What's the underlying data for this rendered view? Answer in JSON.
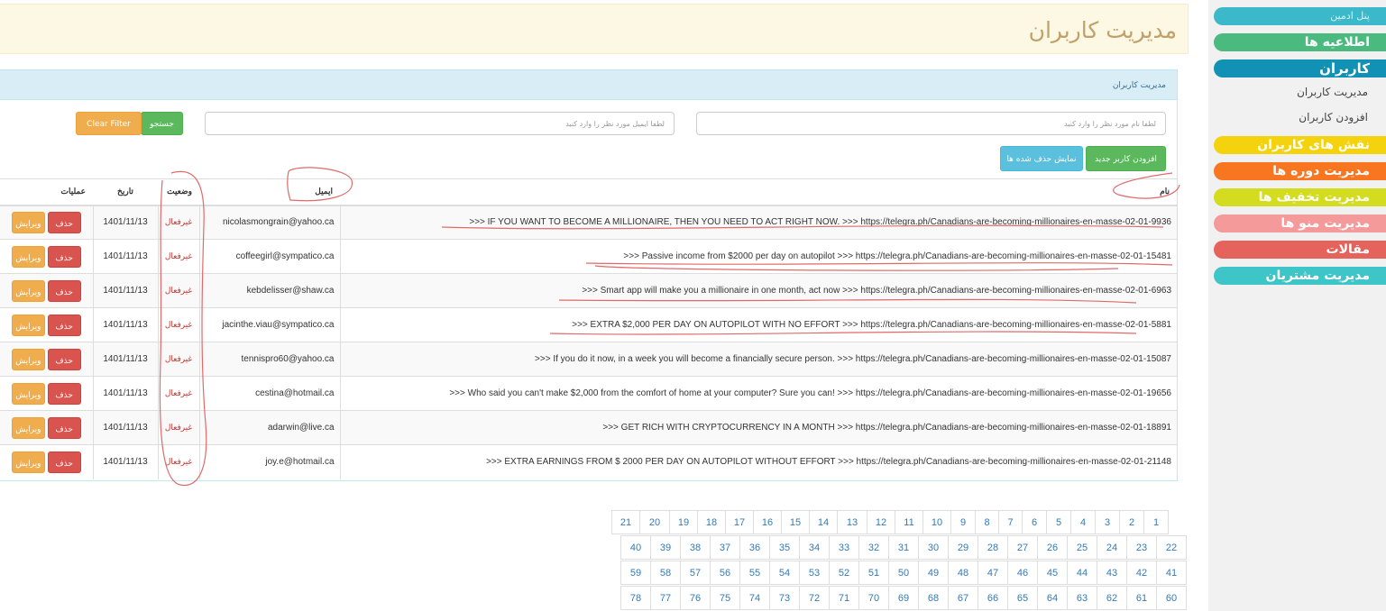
{
  "page_title": "مدیریت کاربران",
  "sidebar": {
    "items": [
      {
        "label": "پنل ادمین",
        "color": "#3bb8c9"
      },
      {
        "label": "اطلاعیه ها",
        "color": "#4aba7f"
      },
      {
        "label": "کاربران",
        "color": "#1191b4"
      },
      {
        "label": "نقش های کاربران",
        "color": "#f5d20e"
      },
      {
        "label": "مدیریت دوره ها",
        "color": "#f97621"
      },
      {
        "label": "مدیریت تخفیف ها",
        "color": "#d4dc1f"
      },
      {
        "label": "مدیریت منو ها",
        "color": "#f49a9a"
      },
      {
        "label": "مقالات",
        "color": "#e5635b"
      },
      {
        "label": "مدیریت مشتریان",
        "color": "#3ec5c8"
      }
    ],
    "subitems": [
      "مدیریت کاربران",
      "افزودن کاربران"
    ]
  },
  "panel": {
    "heading": "مدیریت کاربران",
    "name_placeholder": "لطفا نام مورد نظر را وارد کنید",
    "email_placeholder": "لطفا ایمیل مورد نظر را وارد کنید",
    "search_label": "جستجو",
    "clear_filter_label": "Clear Filter",
    "add_user_label": "افزودن کاربر جدید",
    "show_deleted_label": "نمایش حذف شده ها"
  },
  "table": {
    "headers": {
      "name": "نام",
      "email": "ایمیل",
      "status": "وضعیت",
      "date": "تاریخ",
      "ops": "عملیات"
    },
    "delete_label": "حذف",
    "edit_label": "ویرایش",
    "rows": [
      {
        "name": ">>> IF YOU WANT TO BECOME A MILLIONAIRE, THEN YOU NEED TO ACT RIGHT NOW. >>> https://telegra.ph/Canadians-are-becoming-millionaires-en-masse-02-01-9936",
        "email": "nicolasmongrain@yahoo.ca",
        "status": "غیرفعال",
        "date": "1401/11/13"
      },
      {
        "name": ">>> Passive income from $2000 per day on autopilot >>> https://telegra.ph/Canadians-are-becoming-millionaires-en-masse-02-01-15481",
        "email": "coffeegirl@sympatico.ca",
        "status": "غیرفعال",
        "date": "1401/11/13"
      },
      {
        "name": ">>> Smart app will make you a millionaire in one month, act now >>> https://telegra.ph/Canadians-are-becoming-millionaires-en-masse-02-01-6963",
        "email": "kebdelisser@shaw.ca",
        "status": "غیرفعال",
        "date": "1401/11/13"
      },
      {
        "name": ">>> EXTRA $2,000 PER DAY ON AUTOPILOT WITH NO EFFORT >>> https://telegra.ph/Canadians-are-becoming-millionaires-en-masse-02-01-5881",
        "email": "jacinthe.viau@sympatico.ca",
        "status": "غیرفعال",
        "date": "1401/11/13"
      },
      {
        "name": ">>> If you do it now, in a week you will become a financially secure person. >>> https://telegra.ph/Canadians-are-becoming-millionaires-en-masse-02-01-15087",
        "email": "tennispro60@yahoo.ca",
        "status": "غیرفعال",
        "date": "1401/11/13"
      },
      {
        "name": ">>> Who said you can't make $2,000 from the comfort of home at your computer? Sure you can! >>> https://telegra.ph/Canadians-are-becoming-millionaires-en-masse-02-01-19656",
        "email": "cestina@hotmail.ca",
        "status": "غیرفعال",
        "date": "1401/11/13"
      },
      {
        "name": ">>> GET RICH WITH CRYPTOCURRENCY IN A MONTH >>> https://telegra.ph/Canadians-are-becoming-millionaires-en-masse-02-01-18891",
        "email": "adarwin@live.ca",
        "status": "غیرفعال",
        "date": "1401/11/13"
      },
      {
        "name": ">>> EXTRA EARNINGS FROM $ 2000 PER DAY ON AUTOPILOT WITHOUT EFFORT >>> https://telegra.ph/Canadians-are-becoming-millionaires-en-masse-02-01-21148",
        "email": "joy.e@hotmail.ca",
        "status": "غیرفعال",
        "date": "1401/11/13"
      }
    ]
  },
  "pagination": {
    "rows": [
      [
        "1",
        "2",
        "3",
        "4",
        "5",
        "6",
        "7",
        "8",
        "9",
        "10",
        "11",
        "12",
        "13",
        "14",
        "15",
        "16",
        "17",
        "18",
        "19",
        "20",
        "21"
      ],
      [
        "22",
        "23",
        "24",
        "25",
        "26",
        "27",
        "28",
        "29",
        "30",
        "31",
        "32",
        "33",
        "34",
        "35",
        "36",
        "37",
        "38",
        "39",
        "40"
      ],
      [
        "41",
        "42",
        "43",
        "44",
        "45",
        "46",
        "47",
        "48",
        "49",
        "50",
        "51",
        "52",
        "53",
        "54",
        "55",
        "56",
        "57",
        "58",
        "59"
      ],
      [
        "60",
        "61",
        "62",
        "63",
        "64",
        "65",
        "66",
        "67",
        "68",
        "69",
        "70",
        "71",
        "72",
        "73",
        "74",
        "75",
        "76",
        "77",
        "78"
      ]
    ]
  }
}
